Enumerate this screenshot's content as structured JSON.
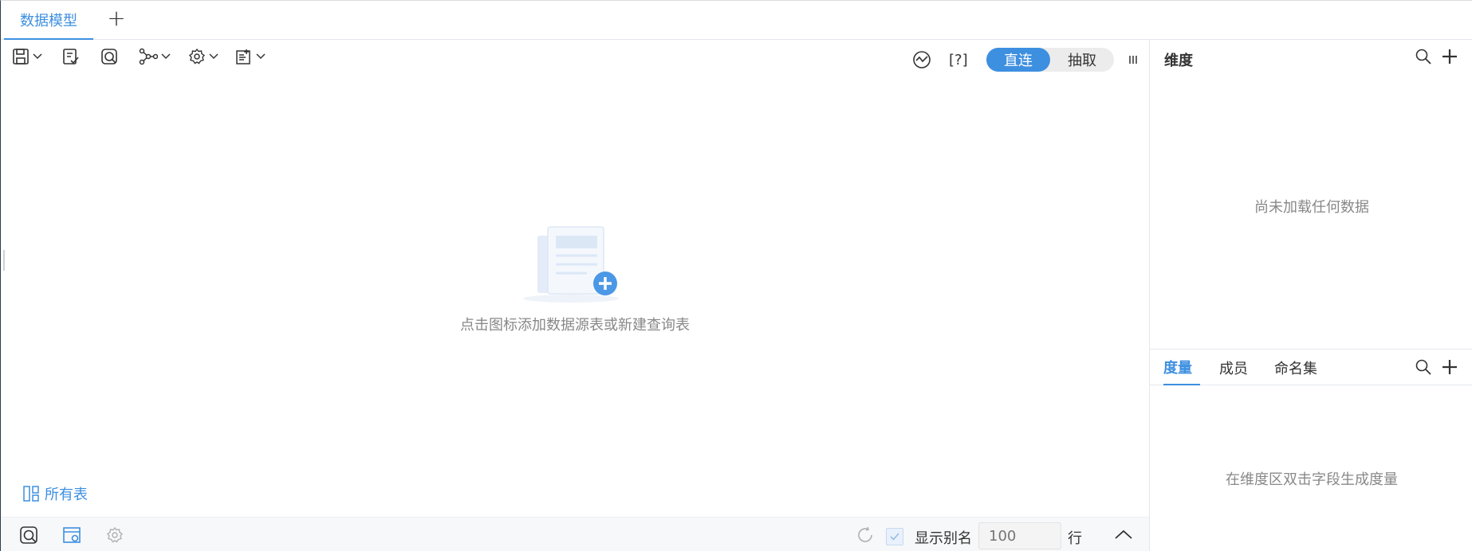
{
  "tabs": [
    {
      "label": "数据模型",
      "active": true
    }
  ],
  "tab_add_label": "+",
  "toolbar": {
    "icons": [
      "save-icon",
      "check-document-icon",
      "query-table-icon",
      "relationship-icon",
      "settings-icon",
      "data-icon"
    ],
    "mode": {
      "options": [
        "直连",
        "抽取"
      ],
      "selected": "直连"
    },
    "help_label": "[?]"
  },
  "canvas": {
    "empty_text": "点击图标添加数据源表或新建查询表",
    "all_tables_label": "所有表"
  },
  "bottombar": {
    "show_alias_label": "显示别名",
    "show_alias_checked": true,
    "rows_placeholder": "100",
    "rows_unit": "行"
  },
  "rightpanel": {
    "dimension_title": "维度",
    "dimension_empty": "尚未加载任何数据",
    "subtabs": [
      "度量",
      "成员",
      "命名集"
    ],
    "active_subtab": "度量",
    "measure_empty": "在维度区双击字段生成度量"
  },
  "colors": {
    "accent": "#3d8fe0",
    "muted_text": "#888888",
    "border": "#e4e7ed"
  }
}
